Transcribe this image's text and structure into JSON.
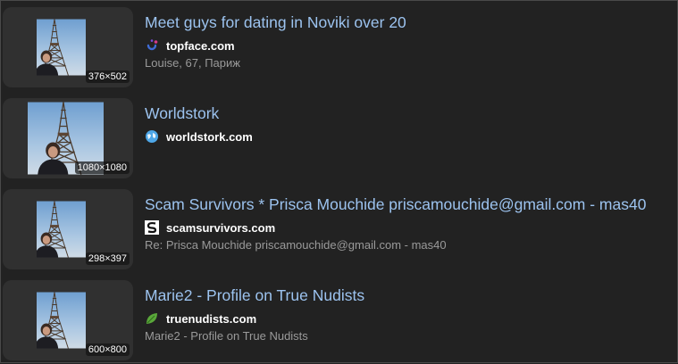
{
  "results": [
    {
      "title": "Meet guys for dating in Noviki over 20",
      "domain": "topface.com",
      "favicon": "topface-icon",
      "snippet": "Louise, 67, Париж",
      "dimensions": "376×502"
    },
    {
      "title": "Worldstork",
      "domain": "worldstork.com",
      "favicon": "globe-icon",
      "snippet": "",
      "dimensions": "1080×1080"
    },
    {
      "title": "Scam Survivors * Prisca Mouchide priscamouchide@gmail.com - mas40",
      "domain": "scamsurvivors.com",
      "favicon": "scamsurvivors-icon",
      "snippet": "Re: Prisca Mouchide priscamouchide@gmail.com - mas40",
      "dimensions": "298×397"
    },
    {
      "title": "Marie2 - Profile on True Nudists",
      "domain": "truenudists.com",
      "favicon": "leaf-icon",
      "snippet": "Marie2 - Profile on True Nudists",
      "dimensions": "600×800"
    }
  ],
  "colors": {
    "background": "#222222",
    "title_link": "#9cc3ef",
    "domain_text": "#ffffff",
    "snippet_text": "#9a9a9a"
  }
}
